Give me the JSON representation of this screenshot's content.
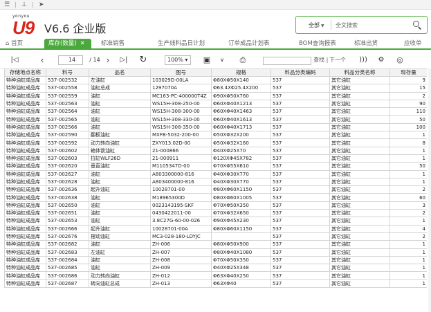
{
  "topbar": {
    "icons": [
      "menu-icon",
      "pin-icon",
      "send-icon"
    ]
  },
  "brand": {
    "small": "yonyou",
    "logo": "U9",
    "version": "V6.6 企业版"
  },
  "search": {
    "scope": "全部",
    "placeholder": "全文搜索"
  },
  "tabs": [
    {
      "label": "首页",
      "active": false
    },
    {
      "label": "库存(数量)",
      "active": true
    },
    {
      "label": "标准销售",
      "active": false
    },
    {
      "label": "生产线料品日计划",
      "active": false
    },
    {
      "label": "订单成品计划表",
      "active": false
    },
    {
      "label": "BOM查询报表",
      "active": false
    },
    {
      "label": "标准出货",
      "active": false
    },
    {
      "label": "应收单",
      "active": false
    }
  ],
  "toolbar": {
    "page": "14",
    "total_pages": "/ 14",
    "zoom": "100%",
    "find_label": "查找",
    "next_label": "下一个"
  },
  "table": {
    "columns": [
      "存储地点名称",
      "料号",
      "品名",
      "图号",
      "规格",
      "料品分类编码",
      "料品分类名称",
      "现存量"
    ],
    "rows": [
      [
        "特种油缸成品库",
        "537-002532",
        "左油缸",
        "103029D-00LA",
        "Φ80XΦ50X140",
        "537",
        "其它油缸",
        "9"
      ],
      [
        "特种油缸成品库",
        "537-002558",
        "油缸总成",
        "1297070A",
        "Φ63.4XΦ25.4X200",
        "537",
        "其它油缸",
        "15"
      ],
      [
        "特种油缸成品库",
        "537-002559",
        "油缸",
        "MC163-PC-400000T4Z",
        "Φ90XΦ50X760",
        "537",
        "其它油缸",
        "2"
      ],
      [
        "特种油缸成品库",
        "537-002563",
        "油缸",
        "WS15H-308-250-00",
        "Φ60XΦ40X1213",
        "537",
        "其它油缸",
        "90"
      ],
      [
        "特种油缸成品库",
        "537-002564",
        "油缸",
        "WS15H-308-300-00",
        "Φ60XΦ40X1463",
        "537",
        "其它油缸",
        "110"
      ],
      [
        "特种油缸成品库",
        "537-002565",
        "油缸",
        "WS15H-308-330-00",
        "Φ60XΦ40X1613",
        "537",
        "其它油缸",
        "50"
      ],
      [
        "特种油缸成品库",
        "537-002566",
        "油缸",
        "WS15H-308-350-00",
        "Φ60XΦ40X1713",
        "537",
        "其它油缸",
        "100"
      ],
      [
        "特种油缸成品库",
        "537-002590",
        "翻板油缸",
        "MXFB-5032-200-00",
        "Φ50XΦ32X200",
        "537",
        "其它油缸",
        "1"
      ],
      [
        "特种油缸成品库",
        "537-002592",
        "动力转向油缸",
        "ZXY013.02D-00",
        "Φ50XΦ32X160",
        "537",
        "其它油缸",
        "8"
      ],
      [
        "特种油缸成品库",
        "537-002602",
        "箱体锁油缸",
        "21-000866",
        "Φ40XΦ25X70",
        "537",
        "其它油缸",
        "1"
      ],
      [
        "特种油缸成品库",
        "537-002603",
        "拉缸WLF26D",
        "21-000911",
        "Φ120XΦ45X782",
        "537",
        "其它油缸",
        "1"
      ],
      [
        "特种油缸成品库",
        "537-002620",
        "垂直油缸",
        "M1105347D-00",
        "Φ70XΦ55X610",
        "537",
        "其它油缸",
        "50"
      ],
      [
        "特种油缸成品库",
        "537-002627",
        "油缸",
        "A803300000-816",
        "Φ40XΦ30X770",
        "537",
        "其它油缸",
        "1"
      ],
      [
        "特种油缸成品库",
        "537-002628",
        "油缸",
        "A803400000-816",
        "Φ40XΦ30X770",
        "537",
        "其它油缸",
        "1"
      ],
      [
        "特种油缸成品库",
        "537-002636",
        "起升油缸",
        "10028701-00",
        "Φ80XΦ60X1150",
        "537",
        "其它油缸",
        "2"
      ],
      [
        "特种油缸成品库",
        "537-002638",
        "油缸",
        "M18965300D",
        "Φ80XΦ60X1005",
        "537",
        "其它油缸",
        "60"
      ],
      [
        "特种油缸成品库",
        "537-002650",
        "油缸",
        "0023143195-SKF",
        "Φ70XΦ50X350",
        "537",
        "其它油缸",
        "3"
      ],
      [
        "特种油缸成品库",
        "537-002651",
        "油缸",
        "0430422011-00",
        "Φ70XΦ32X650",
        "537",
        "其它油缸",
        "2"
      ],
      [
        "特种油缸成品库",
        "537-002653",
        "油缸",
        "3.8C27G-60-00-026",
        "Φ90XΦ45X230",
        "537",
        "其它油缸",
        "1"
      ],
      [
        "特种油缸成品库",
        "537-002666",
        "起升油缸",
        "10028701-00A",
        "Φ80XΦ60X1150",
        "537",
        "其它油缸",
        "4"
      ],
      [
        "特种油缸成品库",
        "537-002676",
        "摆动油缸",
        "MC3-028-180-LDYJC",
        "",
        "537",
        "其它油缸",
        "2"
      ],
      [
        "特种油缸成品库",
        "537-002682",
        "油缸",
        "ZH-006",
        "Φ80XΦ50X900",
        "537",
        "其它油缸",
        "1"
      ],
      [
        "特种油缸成品库",
        "537-002683",
        "左油缸",
        "ZH-007",
        "Φ80XΦ40X1080",
        "537",
        "其它油缸",
        "1"
      ],
      [
        "特种油缸成品库",
        "537-002684",
        "油缸",
        "ZH-008",
        "Φ70XΦ50X350",
        "537",
        "其它油缸",
        "1"
      ],
      [
        "特种油缸成品库",
        "537-002685",
        "油缸",
        "ZH-009",
        "Φ40XΦ25X348",
        "537",
        "其它油缸",
        "1"
      ],
      [
        "特种油缸成品库",
        "537-002686",
        "动力转向油缸",
        "ZH-012",
        "Φ63XΦ40X250",
        "537",
        "其它油缸",
        "1"
      ],
      [
        "特种油缸成品库",
        "537-002687",
        "转向油缸总成",
        "ZH-013",
        "Φ63XΦ40",
        "537",
        "其它油缸",
        "1"
      ]
    ]
  }
}
